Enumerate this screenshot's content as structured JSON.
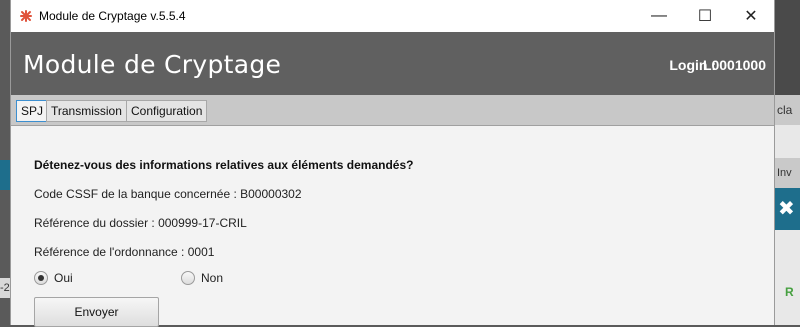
{
  "window": {
    "title": "Module de Cryptage v.5.5.4",
    "controls": {
      "minimize": "—",
      "maximize": "☐",
      "close": "✕"
    }
  },
  "header": {
    "title": "Module de Cryptage",
    "login_label": "Login :",
    "login_value": "L0001000"
  },
  "tabs": [
    {
      "label": "SPJ",
      "active": true
    },
    {
      "label": "Transmission",
      "active": false
    },
    {
      "label": "Configuration",
      "active": false
    }
  ],
  "form": {
    "question": "Détenez-vous des informations relatives aux éléments demandés?",
    "cssf_code": "Code CSSF de la banque concernée : B00000302",
    "dossier_ref": "Référence du dossier : 000999-17-CRIL",
    "ordonnance_ref": "Référence de l'ordonnance : 0001",
    "options": [
      {
        "label": "Oui",
        "selected": true
      },
      {
        "label": "Non",
        "selected": false
      }
    ],
    "submit_label": "Envoyer"
  },
  "background": {
    "right_text_1": "cla",
    "right_text_2": "Inv",
    "left_text": "-2",
    "right_green": "R"
  },
  "colors": {
    "header_bg": "#606060",
    "active_tab_border": "#3c8fd0",
    "app_icon": "#e0533c",
    "background_accent": "#1e6e8c"
  },
  "icons": {
    "app": "red-asterisk-icon",
    "radio_selected": "radio-selected-icon",
    "radio_unselected": "radio-unselected-icon"
  }
}
